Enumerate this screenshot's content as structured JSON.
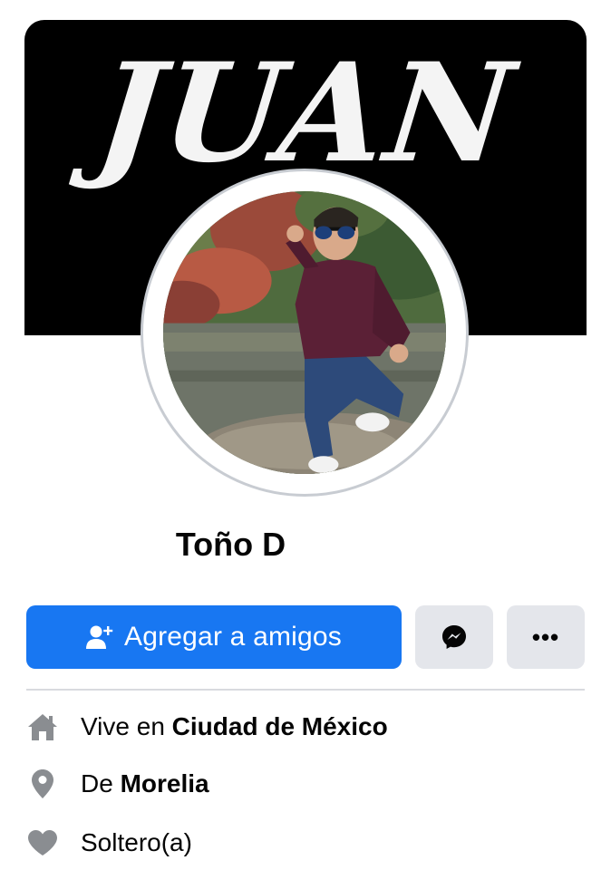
{
  "cover": {
    "title": "JUAN"
  },
  "profile": {
    "name": "Toño D"
  },
  "actions": {
    "add_friend_label": "Agregar a amigos",
    "more_label": "•••"
  },
  "info": {
    "lives_prefix": "Vive en",
    "lives_city": "Ciudad de México",
    "from_prefix": "De",
    "from_city": "Morelia",
    "relationship": "Soltero(a)"
  },
  "colors": {
    "primary_button": "#1877f2",
    "secondary_button": "#e4e6eb",
    "info_icon": "#8a8d91"
  },
  "icons": [
    "add-friend-icon",
    "messenger-icon",
    "more-icon",
    "home-icon",
    "location-pin-icon",
    "heart-icon"
  ]
}
